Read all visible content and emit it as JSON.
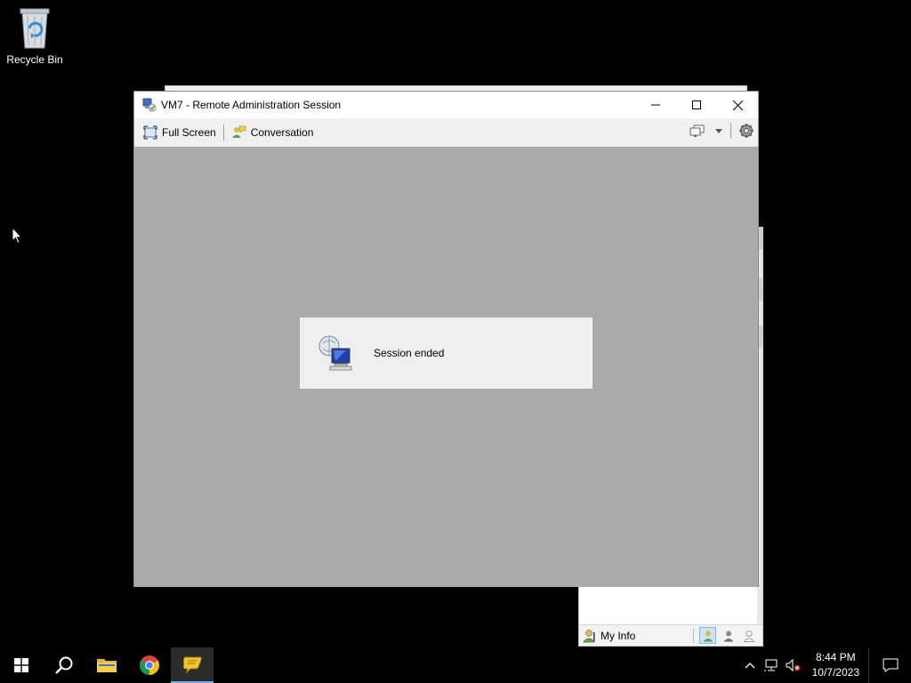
{
  "desktop": {
    "recycle_bin_label": "Recycle Bin"
  },
  "window": {
    "title": "VM7 - Remote Administration Session",
    "minimize_label": "",
    "toolbar": {
      "full_screen_label": "Full Screen",
      "conversation_label": "Conversation"
    },
    "session_message": "Session ended"
  },
  "contacts_window": {
    "my_info_label": "My Info"
  },
  "taskbar": {
    "clock_time": "8:44 PM",
    "clock_date": "10/7/2023"
  },
  "icons": {
    "start": "windows-logo-icon",
    "search": "search-icon",
    "explorer": "folder-icon",
    "chrome": "chrome-icon",
    "chat_app": "chat-bubble-icon"
  },
  "colors": {
    "content_bg": "#aaaaaa",
    "taskbar_bg": "#000000",
    "active_indicator": "#7aa7d8"
  }
}
